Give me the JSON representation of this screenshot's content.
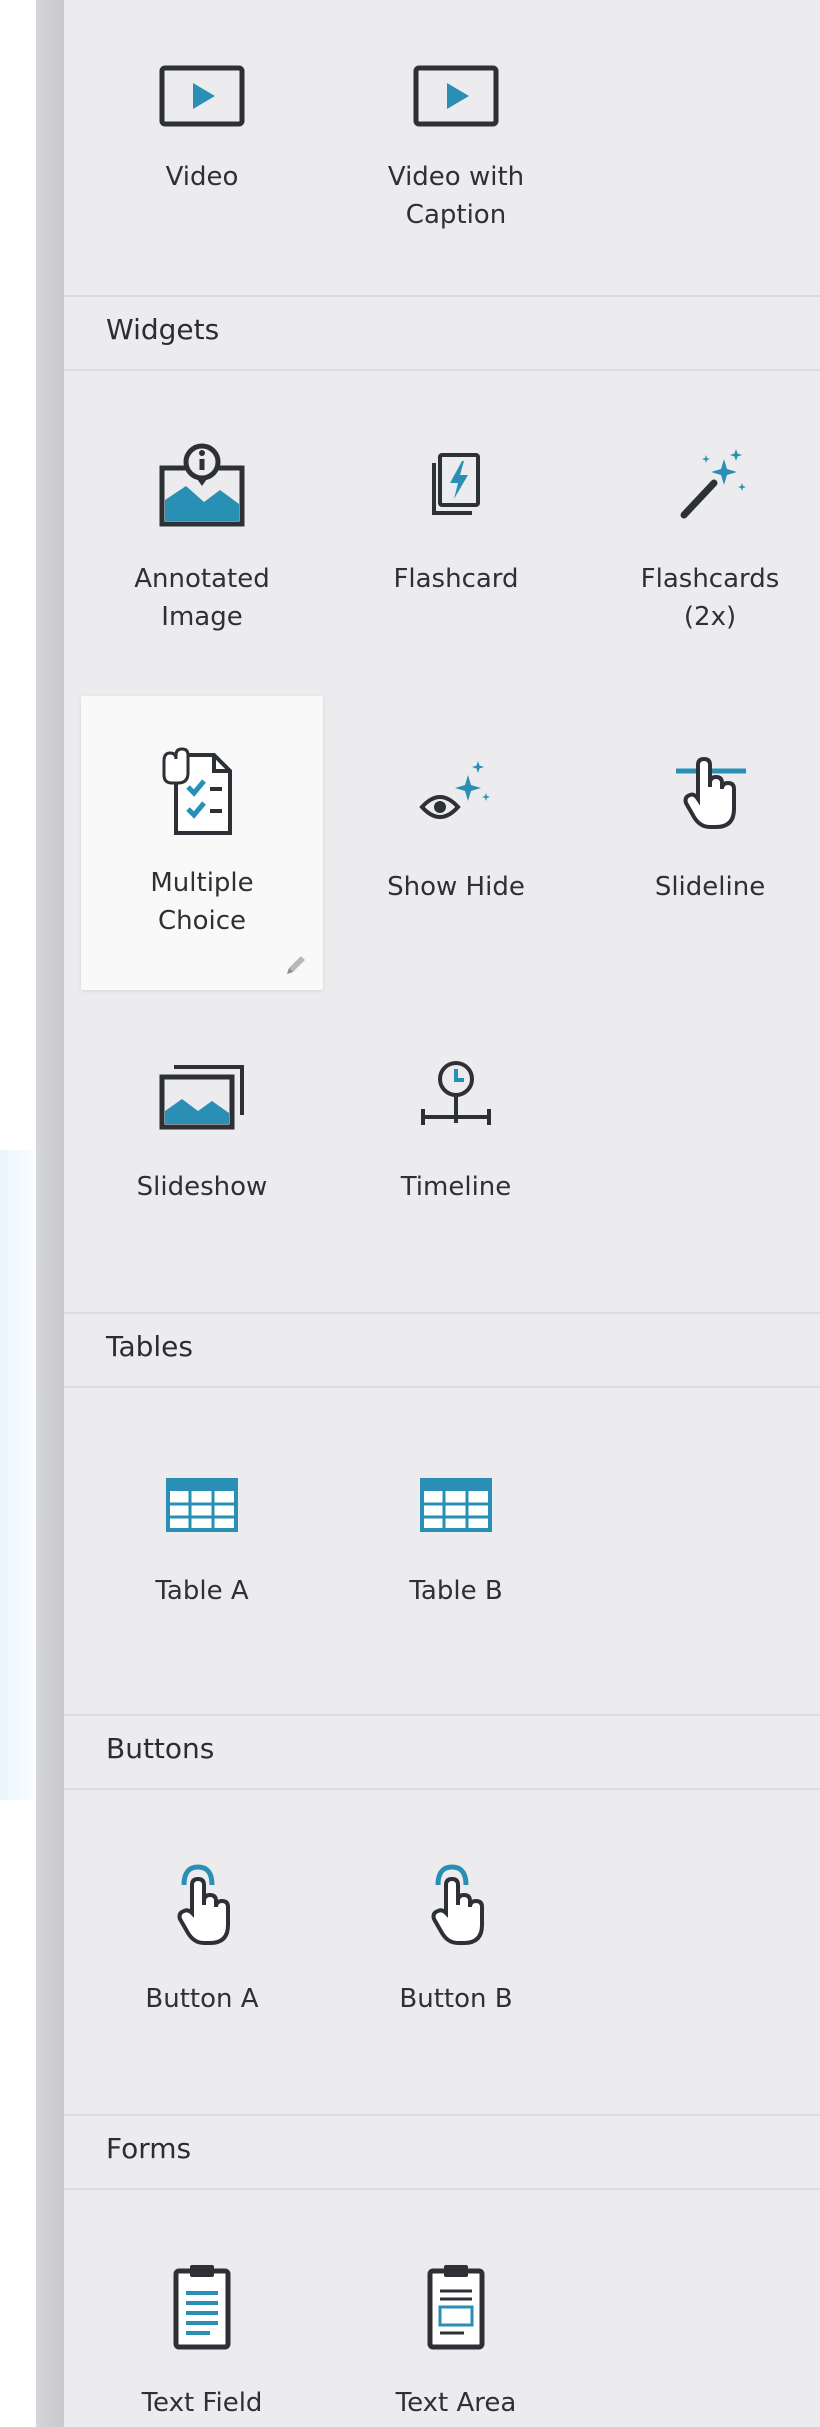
{
  "media": {
    "items": [
      {
        "label": "Video",
        "icon": "video-icon"
      },
      {
        "label": "Video with\nCaption",
        "icon": "video-caption-icon"
      }
    ]
  },
  "widgets": {
    "header": "Widgets",
    "items": [
      {
        "label": "Annotated\nImage",
        "icon": "annotated-image-icon"
      },
      {
        "label": "Flashcard",
        "icon": "flashcard-icon"
      },
      {
        "label": "Flashcards\n(2x)",
        "icon": "magic-wand-icon"
      },
      {
        "label": "Multiple\nChoice",
        "icon": "multiple-choice-icon",
        "selected": true
      },
      {
        "label": "Show Hide",
        "icon": "eye-sparkle-icon"
      },
      {
        "label": "Slideline",
        "icon": "slideline-icon"
      },
      {
        "label": "Slideshow",
        "icon": "slideshow-icon"
      },
      {
        "label": "Timeline",
        "icon": "timeline-icon"
      }
    ]
  },
  "tables": {
    "header": "Tables",
    "items": [
      {
        "label": "Table A",
        "icon": "table-icon"
      },
      {
        "label": "Table B",
        "icon": "table-icon"
      }
    ]
  },
  "buttons": {
    "header": "Buttons",
    "items": [
      {
        "label": "Button A",
        "icon": "tap-hand-icon"
      },
      {
        "label": "Button B",
        "icon": "tap-hand-icon"
      }
    ]
  },
  "forms": {
    "header": "Forms",
    "items": [
      {
        "label": "Text Field",
        "icon": "clipboard-text-field-icon"
      },
      {
        "label": "Text Area",
        "icon": "clipboard-text-area-icon"
      }
    ]
  },
  "colors": {
    "accent": "#2a8fb5",
    "icon_dark": "#2d3136",
    "panel": "#ececee",
    "header_border": "#dcdcde",
    "card": "#f9f9fa"
  }
}
